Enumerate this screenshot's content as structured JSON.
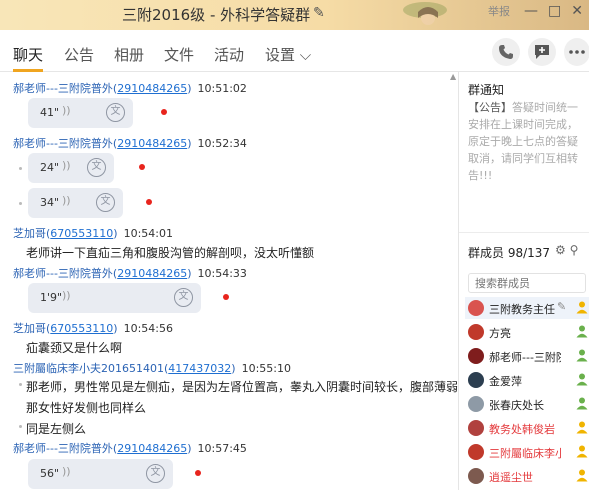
{
  "window": {
    "title": "三附2016级 - 外科学答疑群",
    "menu_label": "举报",
    "edit_icon": "✎",
    "minimize_icon": "—",
    "maximize_icon": "□",
    "close_icon": "✕"
  },
  "tabs": [
    {
      "label": "聊天",
      "active": true
    },
    {
      "label": "公告"
    },
    {
      "label": "相册"
    },
    {
      "label": "文件"
    },
    {
      "label": "活动"
    },
    {
      "label": "设置 ⌵"
    }
  ],
  "toolbar": {
    "call_icon": "✆",
    "message_icon": "✉",
    "more_icon": "•••"
  },
  "messages": [
    {
      "sender": "郝老师---三附院普外",
      "qq": "2910484265",
      "time": "10:51:02",
      "type": "voice",
      "duration": "41\""
    },
    {
      "sender": "郝老师---三附院普外",
      "qq": "2910484265",
      "time": "10:52:34",
      "type": "voice",
      "duration": "24\""
    },
    {
      "type": "voice",
      "duration": "34\""
    },
    {
      "sender": "芝加哥",
      "qq": "670553110",
      "time": "10:54:01",
      "type": "text",
      "text": "老师讲一下直疝三角和腹股沟管的解剖呗，没太听懂额"
    },
    {
      "sender": "郝老师---三附院普外",
      "qq": "2910484265",
      "time": "10:54:33",
      "type": "voice",
      "duration": "1'9\""
    },
    {
      "sender": "芝加哥",
      "qq": "670553110",
      "time": "10:54:56",
      "type": "text",
      "text": "疝囊颈又是什么啊"
    },
    {
      "sender": "三附屬临床李小夫201651401",
      "qq": "417437032",
      "time": "10:55:10",
      "type": "text",
      "text": "那老师，男性常见是左侧疝，是因为左肾位置高，睾丸入阴囊时间较长，腹部薄弱，"
    },
    {
      "type": "text",
      "text": "那女性好发侧也同样么"
    },
    {
      "type": "text",
      "text": "同是左侧么"
    },
    {
      "sender": "郝老师---三附院普外",
      "qq": "2910484265",
      "time": "10:57:45",
      "type": "voice",
      "duration": "56\""
    }
  ],
  "voice_wave": "))",
  "convert_glyph": "文",
  "notice": {
    "title": "群通知",
    "tag": "【公告】",
    "body": "答疑时间统一安排在上课时间完成，原定于晚上七点的答疑取消，请同学们互相转告!!!"
  },
  "members": {
    "header": "群成员 98/137",
    "search_placeholder": "搜索群成员",
    "list": [
      {
        "name": "三附教务主任",
        "color": "#d9534f",
        "red": false,
        "role_color": "#f0b400",
        "edit": true
      },
      {
        "name": "方亮",
        "color": "#c0392b",
        "red": false,
        "role_color": "#6ab04c"
      },
      {
        "name": "郝老师---三附院普外",
        "color": "#7f1d1d",
        "red": false,
        "role_color": "#6ab04c"
      },
      {
        "name": "金爱萍",
        "color": "#2c3e50",
        "red": false,
        "role_color": "#6ab04c"
      },
      {
        "name": "张春庆处长",
        "color": "#8e9aa6",
        "red": false,
        "role_color": "#6ab04c"
      },
      {
        "name": "教务处韩俊岩",
        "color": "#b0413e",
        "red": true,
        "role_color": "#f0b400"
      },
      {
        "name": "三附屬临床李小夫",
        "color": "#c0392b",
        "red": true,
        "role_color": "#f0b400"
      },
      {
        "name": "逍遥尘世",
        "color": "#7d5a4f",
        "red": true,
        "role_color": "#f0b400"
      }
    ]
  },
  "colors": {
    "accent": "#f0a520",
    "link_blue": "#1f6fd1",
    "sender_blue": "#2b63b4",
    "unread_red": "#e8241d",
    "bubble_bg": "#e9ecf2"
  }
}
